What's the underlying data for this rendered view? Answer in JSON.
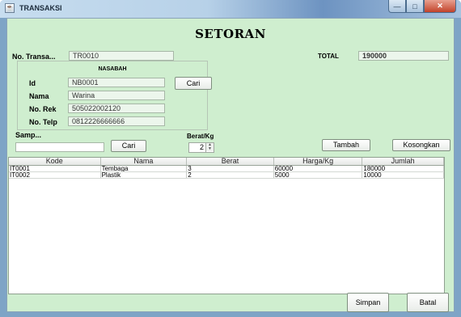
{
  "window": {
    "title": "TRANSAKSI",
    "minimize_glyph": "—",
    "maximize_glyph": "□",
    "close_glyph": "✕"
  },
  "form": {
    "heading": "SETORAN",
    "no_transaksi_label": "No. Transa...",
    "no_transaksi_value": "TR0010",
    "total_label": "TOTAL",
    "total_value": "190000"
  },
  "nasabah": {
    "title": "NASABAH",
    "id_label": "Id",
    "id_value": "NB0001",
    "cari_label": "Cari",
    "nama_label": "Nama",
    "nama_value": "Warina",
    "norek_label": "No. Rek",
    "norek_value": "505022002120",
    "notelp_label": "No. Telp",
    "notelp_value": "0812226666666"
  },
  "sampah": {
    "label": "Samp...",
    "value": "",
    "cari_label": "Cari",
    "berat_label": "Berat/Kg",
    "berat_value": "2",
    "tambah_label": "Tambah",
    "kosongkan_label": "Kosongkan"
  },
  "table": {
    "columns": [
      "Kode",
      "Nama",
      "Berat",
      "Harga/Kg",
      "Jumlah"
    ],
    "rows": [
      [
        "IT0001",
        "Tembaga",
        "3",
        "60000",
        "180000"
      ],
      [
        "IT0002",
        "Plastik",
        "2",
        "5000",
        "10000"
      ]
    ]
  },
  "footer": {
    "simpan_label": "Simpan",
    "batal_label": "Batal"
  },
  "colors": {
    "panel_background": "#cfeecf",
    "titlebar": "#b7d1e8"
  },
  "icons": {
    "window_icon": "java-app-icon"
  }
}
